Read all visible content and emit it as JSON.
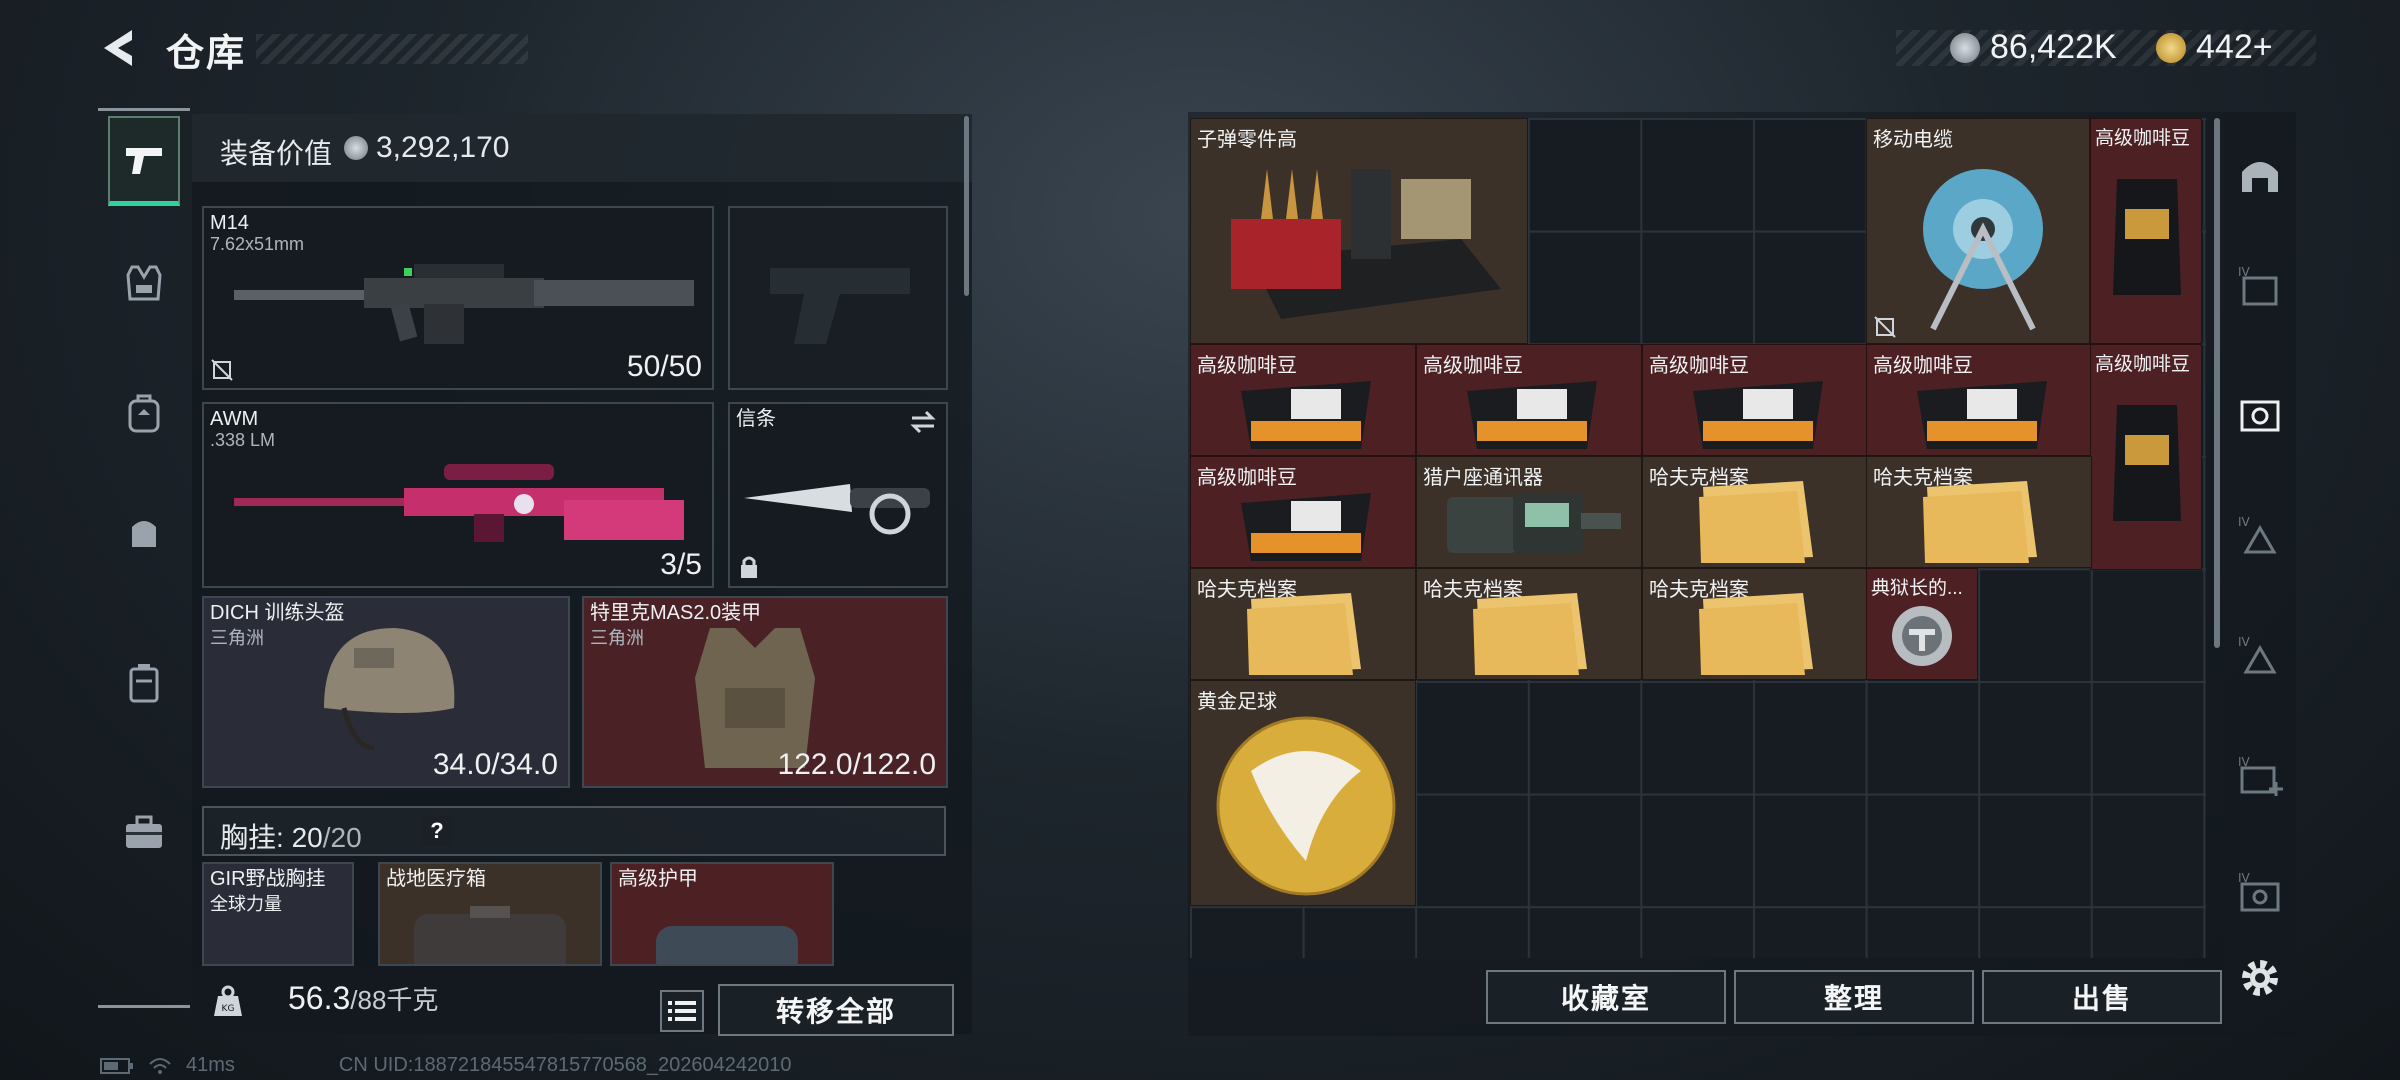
{
  "header": {
    "title": "仓库",
    "currency": [
      {
        "icon": "silver-coin-icon",
        "value": "86,422K"
      },
      {
        "icon": "gold-coin-icon",
        "value": "442+"
      }
    ]
  },
  "left_nav": [
    {
      "icon": "pistol-icon",
      "active": true
    },
    {
      "icon": "vest-icon"
    },
    {
      "icon": "backpack-icon"
    },
    {
      "icon": "pouch-icon"
    },
    {
      "icon": "case-icon"
    },
    {
      "icon": "toolbox-icon"
    }
  ],
  "equipment": {
    "value_label": "装备价值",
    "value": "3,292,170",
    "primary": {
      "name": "M14",
      "ammo": "7.62x51mm",
      "count": "50/50"
    },
    "secondary": {
      "name": "AWM",
      "ammo": ".338 LM",
      "count": "3/5"
    },
    "melee": {
      "name": "信条"
    },
    "helmet": {
      "name": "DICH 训练头盔",
      "sub": "三角洲",
      "durability": "34.0/34.0"
    },
    "armor": {
      "name": "特里克MAS2.0装甲",
      "sub": "三角洲",
      "durability": "122.0/122.0"
    },
    "chest": {
      "label": "胸挂:",
      "current": "20",
      "max": "/20",
      "help": "?"
    },
    "chest_items": [
      {
        "name": "GIR野战胸挂",
        "sub": "全球力量"
      },
      {
        "name": "战地医疗箱"
      },
      {
        "name": "高级护甲"
      }
    ]
  },
  "bottom": {
    "weight": "56.3",
    "weight_max": "/88千克",
    "transfer_all": "转移全部"
  },
  "stash_items": [
    "子弹零件高",
    "移动电缆",
    "高级咖啡豆",
    "高级咖啡豆",
    "高级咖啡豆",
    "高级咖啡豆",
    "高级咖啡豆",
    "高级咖啡豆",
    "高级咖啡豆",
    "猎户座通讯器",
    "哈夫克档案",
    "哈夫克档案",
    "哈夫克档案",
    "哈夫克档案",
    "哈夫克档案",
    "典狱长的...",
    "黄金足球"
  ],
  "stash_buttons": {
    "collection": "收藏室",
    "sort": "整理",
    "sell": "出售"
  },
  "status": {
    "ping": "41ms",
    "uid": "CN UID:188721845547815770568_202604242010"
  },
  "colors": {
    "accent": "#2fd39a",
    "rare_red": "#4d2024",
    "rare_brown": "#3b3128"
  }
}
